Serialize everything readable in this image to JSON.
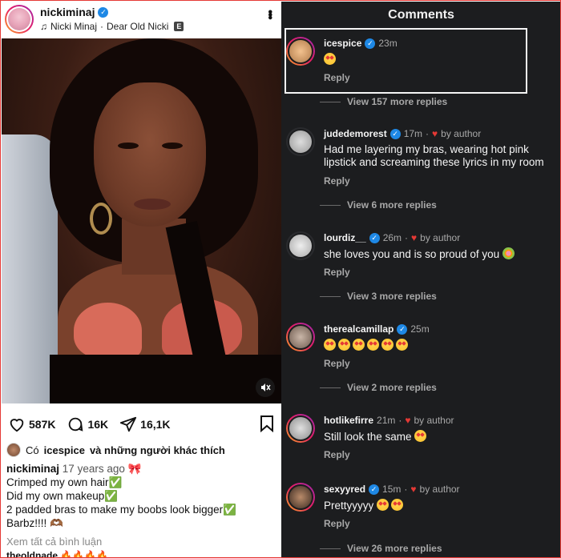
{
  "post": {
    "username": "nickiminaj",
    "artist": "Nicki Minaj",
    "song": "Dear Old Nicki",
    "explicit_badge": "E",
    "likes": "587K",
    "comments": "16K",
    "shares": "16,1K",
    "liked_by_prefix": "Có",
    "liked_by_user": "icespice",
    "liked_by_suffix": "và những người khác thích",
    "caption_user": "nickiminaj",
    "caption_time": "17 years ago",
    "caption_lines": [
      "Crimped my own hair✅",
      "Did my own makeup✅",
      "2 padded bras to make my boobs look bigger✅",
      "Barbz!!!! 🫶🏾"
    ],
    "view_all_comments": "Xem tất cả bình luận",
    "next_comment_partial": "theoldnade 🔥🔥🔥🔥"
  },
  "comments_panel": {
    "title": "Comments",
    "items": [
      {
        "user": "icespice",
        "time": "23m",
        "verified": true,
        "by_author": "",
        "text": "😍",
        "reply": "Reply",
        "view_replies": "View 157 more replies"
      },
      {
        "user": "judedemorest",
        "time": "17m",
        "verified": true,
        "by_author": "by author",
        "text": "Had me layering my bras, wearing hot pink",
        "text2": "lipstick and screaming these lyrics in my room",
        "reply": "Reply",
        "view_replies": "View 6 more replies"
      },
      {
        "user": "lourdiz__",
        "time": "26m",
        "verified": true,
        "by_author": "by author",
        "text": "she loves you and is so proud of you",
        "reply": "Reply",
        "view_replies": "View 3 more replies"
      },
      {
        "user": "therealcamillap",
        "time": "25m",
        "verified": true,
        "by_author": "",
        "text": "😍😍😍😍😍😍",
        "reply": "Reply",
        "view_replies": "View 2 more replies"
      },
      {
        "user": "hotlikefirre",
        "time": "21m",
        "verified": false,
        "by_author": "by author",
        "text": "Still look the same",
        "reply": "Reply"
      },
      {
        "user": "sexyyred",
        "time": "15m",
        "verified": true,
        "by_author": "by author",
        "text": "Prettyyyyy",
        "reply": "Reply",
        "view_replies": "View 26 more replies"
      }
    ]
  },
  "colors": {
    "accent_blue": "#1e88e5",
    "heart_red": "#e53935",
    "dark_bg": "#1c1d1f",
    "frame_red": "#e53935"
  }
}
